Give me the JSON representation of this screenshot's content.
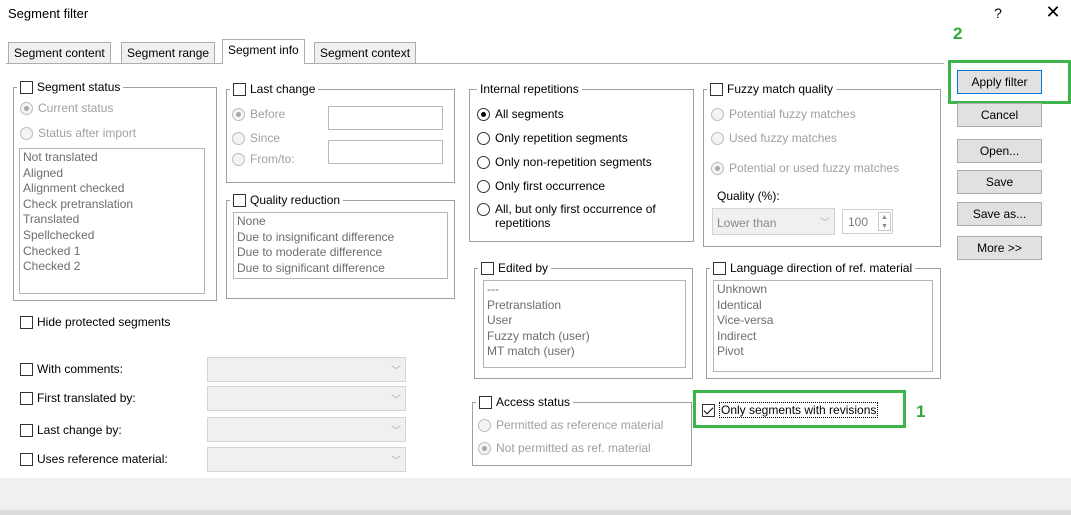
{
  "window": {
    "title": "Segment filter",
    "help": "?",
    "close": "✕"
  },
  "tabs": [
    "Segment content",
    "Segment range",
    "Segment info",
    "Segment context"
  ],
  "segment_status": {
    "label": "Segment status",
    "radio_current": "Current status",
    "radio_import": "Status after import",
    "list": [
      "Not translated",
      "Aligned",
      "Alignment checked",
      "Check pretranslation",
      "Translated",
      "Spellchecked",
      "Checked 1",
      "Checked 2"
    ]
  },
  "last_change": {
    "label": "Last change",
    "before": "Before",
    "since": "Since",
    "fromto": "From/to:"
  },
  "quality_reduction": {
    "label": "Quality reduction",
    "list": [
      "None",
      "Due to insignificant difference",
      "Due to moderate difference",
      "Due to significant difference"
    ]
  },
  "internal_repetitions": {
    "label": "Internal repetitions",
    "options": [
      "All segments",
      "Only repetition segments",
      "Only non-repetition segments",
      "Only first occurrence",
      "All, but only first occurrence of",
      "repetitions"
    ]
  },
  "fuzzy": {
    "label": "Fuzzy match quality",
    "potential": "Potential fuzzy matches",
    "used": "Used fuzzy matches",
    "either": "Potential or used fuzzy matches",
    "quality_label": "Quality (%):",
    "operator": "Lower than",
    "value": "100"
  },
  "edited_by": {
    "label": "Edited by",
    "list": [
      "---",
      "Pretranslation",
      "User",
      "Fuzzy match (user)",
      "MT match (user)"
    ]
  },
  "language_direction": {
    "label": "Language direction of ref. material",
    "list": [
      "Unknown",
      "Identical",
      "Vice-versa",
      "Indirect",
      "Pivot"
    ]
  },
  "access_status": {
    "label": "Access status",
    "permitted": "Permitted as reference material",
    "not_permitted": "Not permitted as ref. material"
  },
  "hide_protected": "Hide protected segments",
  "with_comments": "With comments:",
  "first_translated": "First translated by:",
  "last_change_by": "Last change by:",
  "uses_reference": "Uses reference material:",
  "only_revisions": "Only segments with revisions",
  "buttons": {
    "apply": "Apply filter",
    "cancel": "Cancel",
    "open": "Open...",
    "save": "Save",
    "save_as": "Save as...",
    "more": "More >>"
  },
  "annotations": {
    "one": "1",
    "two": "2"
  },
  "colors": {
    "highlight": "#3cb54a",
    "accent": "#0078d7"
  }
}
